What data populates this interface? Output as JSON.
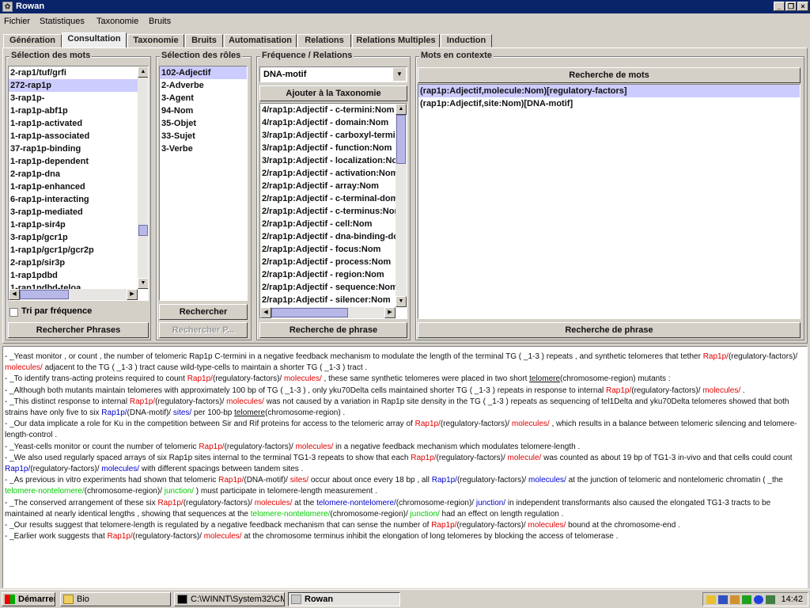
{
  "window": {
    "title": "Rowan"
  },
  "menu": [
    "Fichier",
    "Statistiques",
    "Taxonomie",
    "Bruits"
  ],
  "tabs": [
    "Génération",
    "Consultation",
    "Taxonomie",
    "Bruits",
    "Automatisation",
    "Relations",
    "Relations Multiples",
    "Induction"
  ],
  "active_tab": "Consultation",
  "panels": {
    "mots": {
      "title": "Sélection des mots",
      "items": [
        "2-rap1/tuf/grfi",
        "272-rap1p",
        "3-rap1p-",
        "1-rap1p-abf1p",
        "1-rap1p-activated",
        "1-rap1p-associated",
        "37-rap1p-binding",
        "1-rap1p-dependent",
        "2-rap1p-dna",
        "1-rap1p-enhanced",
        "6-rap1p-interacting",
        "3-rap1p-mediated",
        "1-rap1p-sir4p",
        "3-rap1p/gcr1p",
        "1-rap1p/gcr1p/gcr2p",
        "2-rap1p/sir3p",
        "1-rap1pdbd",
        "1-rap1pdbd-teloa"
      ],
      "selected_index": 1,
      "checkbox_label": "Tri par fréquence",
      "button": "Rechercher Phrases"
    },
    "roles": {
      "title": "Sélection des rôles",
      "items": [
        "102-Adjectif",
        "2-Adverbe",
        "3-Agent",
        "94-Nom",
        "35-Objet",
        "33-Sujet",
        "3-Verbe"
      ],
      "selected_index": 0,
      "button_search": "Rechercher",
      "button_disabled": "Rechercher P..."
    },
    "freq": {
      "title": "Fréquence / Relations",
      "combo_value": "DNA-motif",
      "add_button": "Ajouter à la Taxonomie",
      "items": [
        "4/rap1p:Adjectif - c-termini:Nom",
        "4/rap1p:Adjectif - domain:Nom",
        "3/rap1p:Adjectif - carboxyl-terminu",
        "3/rap1p:Adjectif - function:Nom",
        "3/rap1p:Adjectif - localization:Nom",
        "2/rap1p:Adjectif - activation:Nom",
        "2/rap1p:Adjectif - array:Nom",
        "2/rap1p:Adjectif - c-terminal-doma",
        "2/rap1p:Adjectif - c-terminus:Nom",
        "2/rap1p:Adjectif - cell:Nom",
        "2/rap1p:Adjectif - dna-binding-dom",
        "2/rap1p:Adjectif - focus:Nom",
        "2/rap1p:Adjectif - process:Nom",
        "2/rap1p:Adjectif - region:Nom",
        "2/rap1p:Adjectif - sequence:Nom",
        "2/rap1p:Adjectif - silencer:Nom"
      ],
      "button": "Recherche de phrase"
    },
    "context": {
      "title": "Mots en contexte",
      "top_button": "Recherche de mots",
      "items": [
        "(rap1p:Adjectif,molecule:Nom)[regulatory-factors]",
        "(rap1p:Adjectif,site:Nom)[DNA-motif]"
      ],
      "selected_index": 0,
      "button": "Recherche de phrase"
    }
  },
  "colors": {
    "red": "#e00000",
    "blue": "#0000cc",
    "green": "#00cc00",
    "selection": "#ccccff",
    "titlebar": "#0a246a"
  },
  "sentences": [
    [
      [
        "- _Yeast monitor , or count , the number of telomeric Rap1p C-termini in a negative feedback mechanism to modulate the length of the terminal TG ( _1-3 ) repeats , and synthetic telomeres that tether ",
        ""
      ],
      [
        "Rap1p/",
        "r"
      ],
      [
        "(regulatory-factors)/ ",
        ""
      ],
      [
        "molecules/",
        "r"
      ],
      [
        " adjacent to the TG ( _1-3 ) tract cause wild-type-cells to maintain a shorter TG ( _1-3 ) tract .",
        ""
      ]
    ],
    [
      [
        "- _To identify trans-acting proteins required to count ",
        ""
      ],
      [
        "Rap1p/",
        "r"
      ],
      [
        "(regulatory-factors)/ ",
        ""
      ],
      [
        "molecules/",
        "r"
      ],
      [
        " , these same synthetic telomeres were placed in two short ",
        ""
      ],
      [
        "telomere",
        "u"
      ],
      [
        "(chromosome-region) mutants :",
        ""
      ]
    ],
    [
      [
        "- _Although both mutants maintain telomeres with approximately 100 bp of TG ( _1-3 ) , only yku70Delta cells maintained shorter TG ( _1-3 ) repeats in response to internal ",
        ""
      ],
      [
        "Rap1p/",
        "r"
      ],
      [
        "(regulatory-factors)/ ",
        ""
      ],
      [
        "molecules/",
        "r"
      ],
      [
        " .",
        ""
      ]
    ],
    [
      [
        "- _This distinct response to internal ",
        ""
      ],
      [
        "Rap1p/",
        "r"
      ],
      [
        "(regulatory-factors)/ ",
        ""
      ],
      [
        "molecules/",
        "r"
      ],
      [
        " was not caused by a variation in Rap1p site density in the TG ( _1-3 ) repeats as sequencing of tel1Delta and yku70Delta telomeres showed that both strains have only five to six ",
        ""
      ],
      [
        "Rap1p/",
        "b"
      ],
      [
        "(DNA-motif)/ ",
        ""
      ],
      [
        "sites/",
        "b"
      ],
      [
        " per 100-bp ",
        ""
      ],
      [
        "telomere",
        "u"
      ],
      [
        "(chromosome-region) .",
        ""
      ]
    ],
    [
      [
        "- _Our data implicate a role for Ku in the competition between Sir and Rif proteins for access to the telomeric array of ",
        ""
      ],
      [
        "Rap1p/",
        "r"
      ],
      [
        "(regulatory-factors)/ ",
        ""
      ],
      [
        "molecules/",
        "r"
      ],
      [
        " , which results in a balance between telomeric silencing and telomere-length-control .",
        ""
      ]
    ],
    [
      [
        "- _Yeast-cells monitor or count the number of telomeric ",
        ""
      ],
      [
        "Rap1p/",
        "r"
      ],
      [
        "(regulatory-factors)/ ",
        ""
      ],
      [
        "molecules/",
        "r"
      ],
      [
        " in a negative feedback mechanism which modulates telomere-length .",
        ""
      ]
    ],
    [
      [
        "- _We also used regularly spaced arrays of six Rap1p sites internal to the terminal TG1-3 repeats to show that each ",
        ""
      ],
      [
        "Rap1p/",
        "r"
      ],
      [
        "(regulatory-factors)/ ",
        ""
      ],
      [
        "molecule/",
        "r"
      ],
      [
        " was counted as about 19 bp of TG1-3 in-vivo and that cells could count ",
        ""
      ],
      [
        "Rap1p/",
        "b"
      ],
      [
        "(regulatory-factors)/ ",
        ""
      ],
      [
        "molecules/",
        "b"
      ],
      [
        " with different spacings between tandem sites .",
        ""
      ]
    ],
    [
      [
        "- _As previous in vitro experiments had shown that telomeric ",
        ""
      ],
      [
        "Rap1p/",
        "r"
      ],
      [
        "(DNA-motif)/ ",
        ""
      ],
      [
        "sites/",
        "r"
      ],
      [
        " occur about once every 18 bp , all ",
        ""
      ],
      [
        "Rap1p/",
        "b"
      ],
      [
        "(regulatory-factors)/ ",
        ""
      ],
      [
        "molecules/",
        "b"
      ],
      [
        " at the junction of telomeric and nontelomeric chromatin ( _the ",
        ""
      ],
      [
        "telomere-nontelomere/",
        "g"
      ],
      [
        "(chromosome-region)/ ",
        ""
      ],
      [
        "junction/",
        "g"
      ],
      [
        " ) must participate in telomere-length measurement .",
        ""
      ]
    ],
    [
      [
        "- _The conserved arrangement of these six ",
        ""
      ],
      [
        "Rap1p/",
        "r"
      ],
      [
        "(regulatory-factors)/ ",
        ""
      ],
      [
        "molecules/",
        "r"
      ],
      [
        " at the ",
        ""
      ],
      [
        "telomere-nontelomere/",
        "b"
      ],
      [
        "(chromosome-region)/ ",
        ""
      ],
      [
        "junction/",
        "b"
      ],
      [
        " in independent transformants also caused the elongated TG1-3 tracts to be maintained at nearly identical lengths , showing that sequences at the ",
        ""
      ],
      [
        "telomere-nontelomere/",
        "g"
      ],
      [
        "(chromosome-region)/ ",
        ""
      ],
      [
        "junction/",
        "g"
      ],
      [
        " had an effect on length regulation .",
        ""
      ]
    ],
    [
      [
        "- _Our results suggest that telomere-length is regulated by a negative feedback mechanism that can sense the number of ",
        ""
      ],
      [
        "Rap1p/",
        "r"
      ],
      [
        "(regulatory-factors)/ ",
        ""
      ],
      [
        "molecules/",
        "r"
      ],
      [
        " bound at the chromosome-end .",
        ""
      ]
    ],
    [
      [
        "- _Earlier work suggests that ",
        ""
      ],
      [
        "Rap1p/",
        "r"
      ],
      [
        "(regulatory-factors)/ ",
        ""
      ],
      [
        "molecules/",
        "r"
      ],
      [
        " at the chromosome terminus inhibit the elongation of long telomeres by blocking the access of telomerase .",
        ""
      ]
    ]
  ],
  "taskbar": {
    "start": "Démarrer",
    "buttons": [
      "Bio",
      "C:\\WINNT\\System32\\CM...",
      "Rowan"
    ],
    "active": "Rowan",
    "clock": "14:42"
  }
}
